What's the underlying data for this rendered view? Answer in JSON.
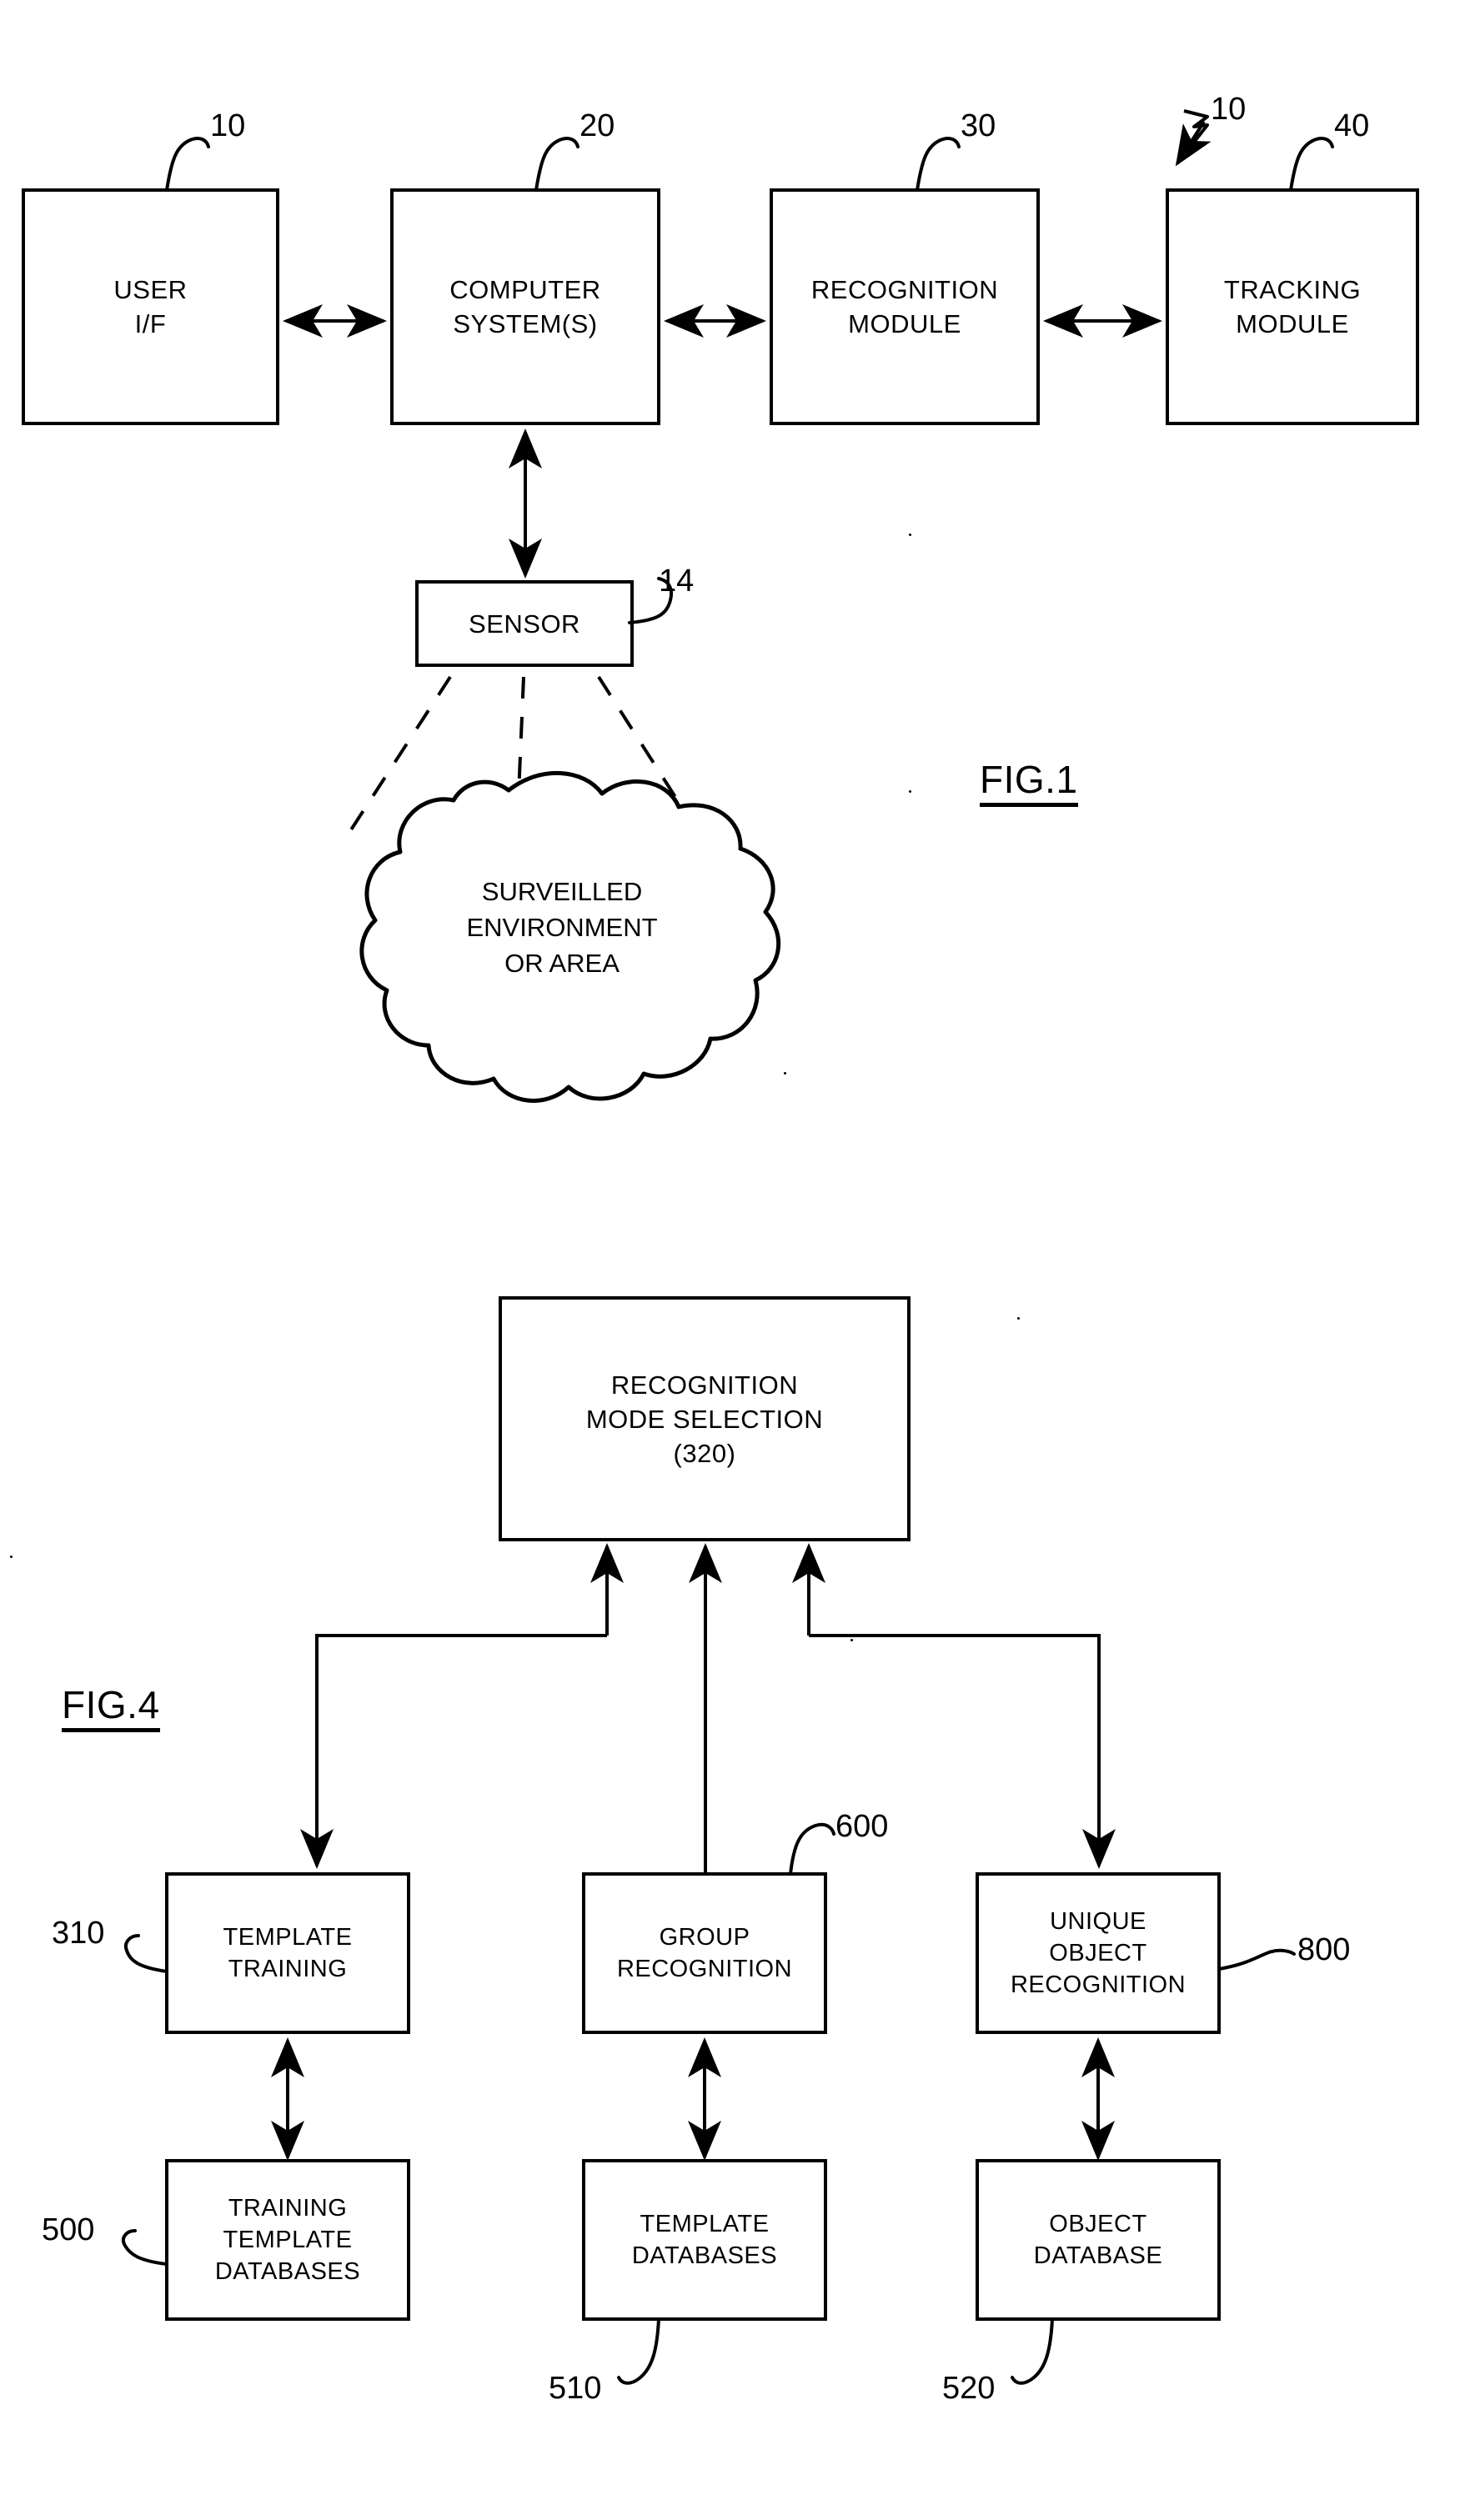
{
  "document": {
    "kind": "patent-drawing-sheet",
    "figures": [
      {
        "id": "fig1",
        "label": "FIG.1",
        "boxes": [
          {
            "id": "user_if",
            "text": "USER\nI/F",
            "ref": "10"
          },
          {
            "id": "computer",
            "text": "COMPUTER\nSYSTEM(S)",
            "ref": "20"
          },
          {
            "id": "recognition",
            "text": "RECOGNITION\nMODULE",
            "ref": "30"
          },
          {
            "id": "tracking",
            "text": "TRACKING\nMODULE",
            "ref": "40"
          },
          {
            "id": "sensor",
            "text": "SENSOR",
            "ref": "14"
          }
        ],
        "system_ref": "10",
        "cloud": {
          "id": "environment",
          "text": "SURVEILLED\nENVIRONMENT\nOR  AREA"
        }
      },
      {
        "id": "fig4",
        "label": "FIG.4",
        "boxes": [
          {
            "id": "mode_selection",
            "text": "RECOGNITION\nMODE  SELECTION\n(320)",
            "ref": ""
          },
          {
            "id": "template_training",
            "text": "TEMPLATE\nTRAINING",
            "ref": "310"
          },
          {
            "id": "group_recognition",
            "text": "GROUP\nRECOGNITION",
            "ref": "600"
          },
          {
            "id": "unique_object",
            "text": "UNIQUE\nOBJECT\nRECOGNITION",
            "ref": "800"
          },
          {
            "id": "training_template_db",
            "text": "TRAINING\nTEMPLATE\nDATABASES",
            "ref": "500"
          },
          {
            "id": "template_db",
            "text": "TEMPLATE\nDATABASES",
            "ref": "510"
          },
          {
            "id": "object_db",
            "text": "OBJECT\nDATABASE",
            "ref": "520"
          }
        ]
      }
    ]
  },
  "fig1": {
    "label": "FIG.1",
    "system_ref": "10",
    "user_if": {
      "text": "USER\nI/F",
      "ref": "10"
    },
    "computer": {
      "text": "COMPUTER\nSYSTEM(S)",
      "ref": "20"
    },
    "recognition": {
      "text": "RECOGNITION\nMODULE",
      "ref": "30"
    },
    "tracking": {
      "text": "TRACKING\nMODULE",
      "ref": "40"
    },
    "sensor": {
      "text": "SENSOR",
      "ref": "14"
    },
    "environment": {
      "text": "SURVEILLED\nENVIRONMENT\nOR  AREA"
    }
  },
  "fig4": {
    "label": "FIG.4",
    "mode_selection": {
      "text": "RECOGNITION\nMODE  SELECTION\n(320)"
    },
    "template_training": {
      "text": "TEMPLATE\nTRAINING",
      "ref": "310"
    },
    "group_recognition": {
      "text": "GROUP\nRECOGNITION",
      "ref": "600"
    },
    "unique_object": {
      "text": "UNIQUE\nOBJECT\nRECOGNITION",
      "ref": "800"
    },
    "training_template_db": {
      "text": "TRAINING\nTEMPLATE\nDATABASES",
      "ref": "500"
    },
    "template_db": {
      "text": "TEMPLATE\nDATABASES",
      "ref": "510"
    },
    "object_db": {
      "text": "OBJECT\nDATABASE",
      "ref": "520"
    }
  },
  "colors": {
    "ink": "#000000",
    "paper": "#ffffff"
  }
}
